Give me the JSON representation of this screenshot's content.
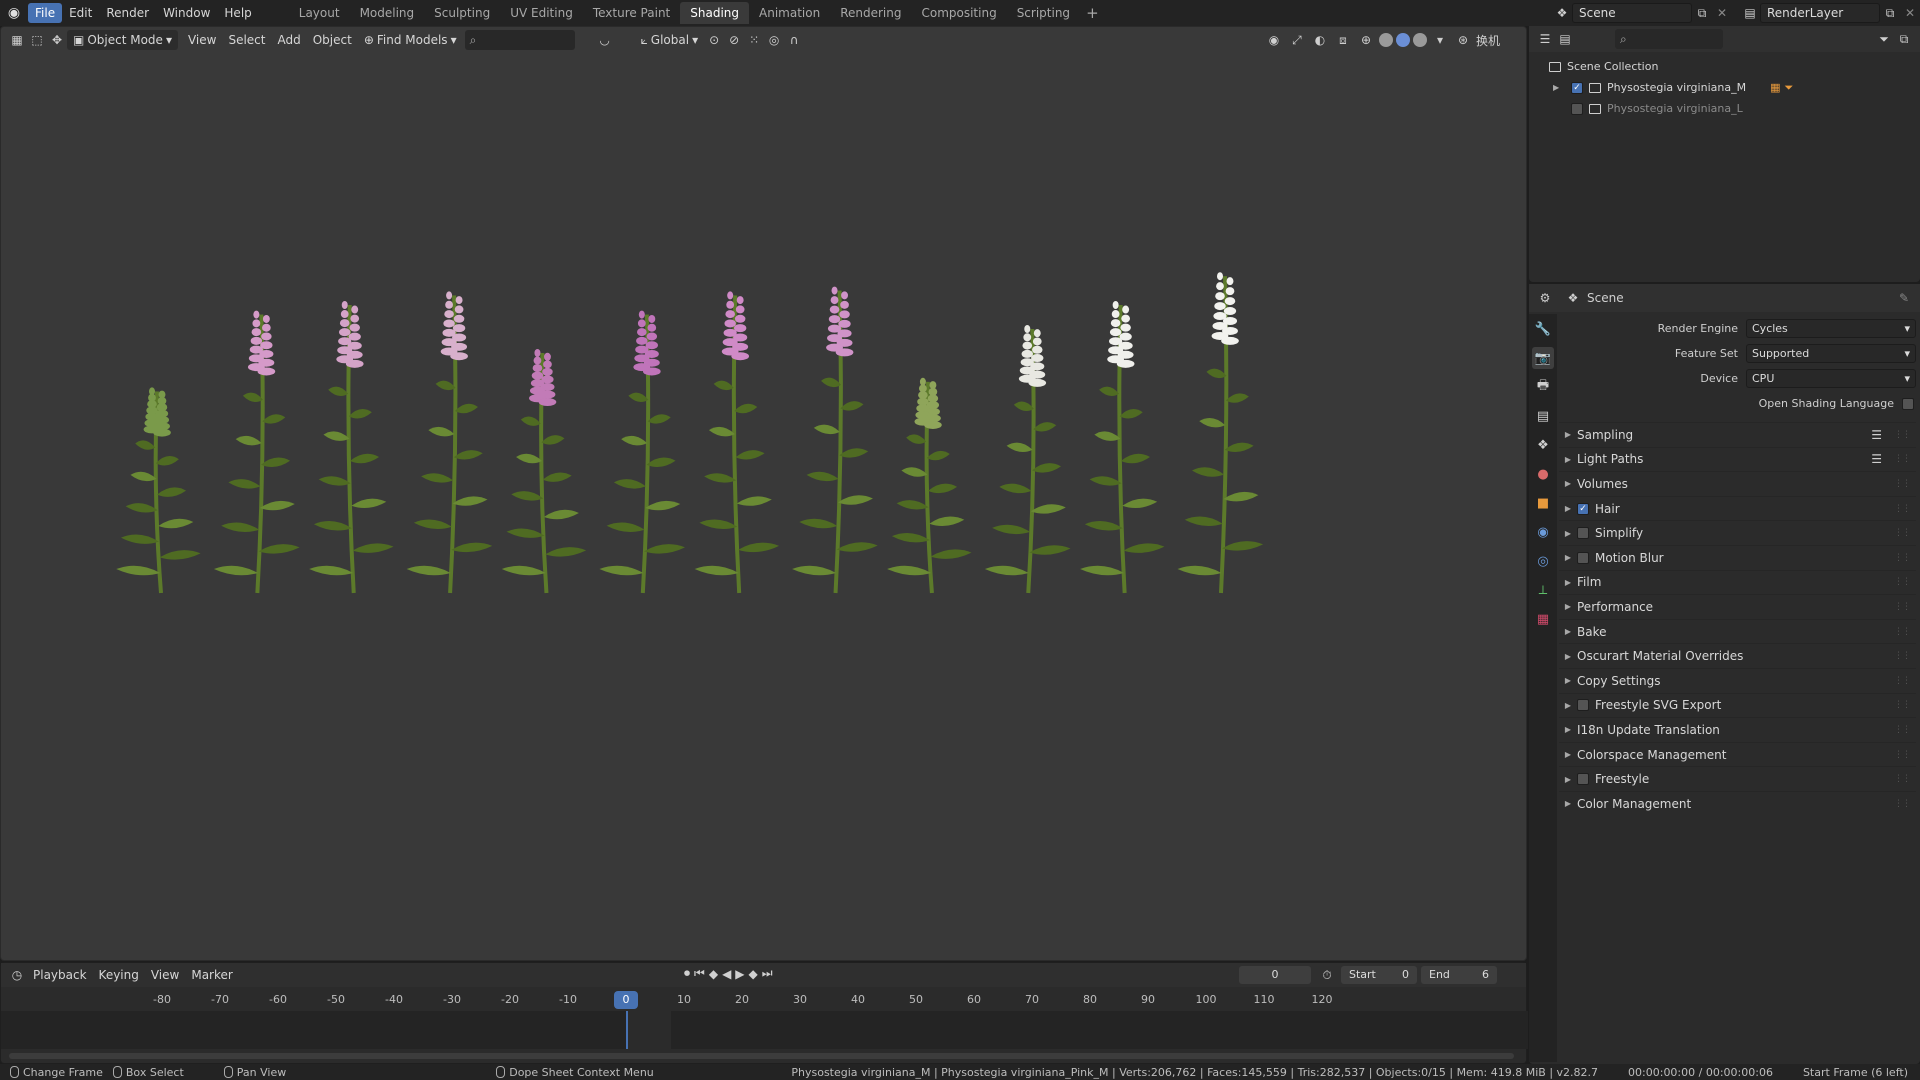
{
  "menu": [
    "File",
    "Edit",
    "Render",
    "Window",
    "Help"
  ],
  "workspaces": [
    "Layout",
    "Modeling",
    "Sculpting",
    "UV Editing",
    "Texture Paint",
    "Shading",
    "Animation",
    "Rendering",
    "Compositing",
    "Scripting"
  ],
  "active_workspace": "Shading",
  "scene_name": "Scene",
  "view_layer": "RenderLayer",
  "viewport": {
    "mode": "Object Mode",
    "menus": [
      "View",
      "Select",
      "Add",
      "Object"
    ],
    "addon_label": "Find Models",
    "transform_orientation": "Global",
    "camera_label": "换机"
  },
  "timeline": {
    "menus": [
      "Playback",
      "Keying",
      "View",
      "Marker"
    ],
    "current_frame": "0",
    "start_label": "Start",
    "start": "0",
    "end_label": "End",
    "end": "6",
    "ticks": [
      "-80",
      "-70",
      "-60",
      "-50",
      "-40",
      "-30",
      "-20",
      "-10",
      "0",
      "10",
      "20",
      "30",
      "40",
      "50",
      "60",
      "70",
      "80",
      "90",
      "100",
      "110",
      "120"
    ]
  },
  "outliner": {
    "root": "Scene Collection",
    "items": [
      {
        "label": "Physostegia virginiana_M",
        "checked": true
      },
      {
        "label": "Physostegia virginiana_L",
        "checked": false
      }
    ]
  },
  "properties": {
    "context": "Scene",
    "render_engine_label": "Render Engine",
    "render_engine": "Cycles",
    "feature_set_label": "Feature Set",
    "feature_set": "Supported",
    "device_label": "Device",
    "device": "CPU",
    "osl_label": "Open Shading Language",
    "panels": [
      {
        "label": "Sampling",
        "checkbox": null,
        "preset": true
      },
      {
        "label": "Light Paths",
        "checkbox": null,
        "preset": true
      },
      {
        "label": "Volumes",
        "checkbox": null,
        "preset": false
      },
      {
        "label": "Hair",
        "checkbox": true,
        "preset": false
      },
      {
        "label": "Simplify",
        "checkbox": false,
        "preset": false
      },
      {
        "label": "Motion Blur",
        "checkbox": false,
        "preset": false
      },
      {
        "label": "Film",
        "checkbox": null,
        "preset": false
      },
      {
        "label": "Performance",
        "checkbox": null,
        "preset": false
      },
      {
        "label": "Bake",
        "checkbox": null,
        "preset": false
      },
      {
        "label": "Oscurart Material Overrides",
        "checkbox": null,
        "preset": false
      },
      {
        "label": "Copy Settings",
        "checkbox": null,
        "preset": false
      },
      {
        "label": "Freestyle SVG Export",
        "checkbox": false,
        "preset": false
      },
      {
        "label": "I18n Update Translation",
        "checkbox": null,
        "preset": false
      },
      {
        "label": "Colorspace Management",
        "checkbox": null,
        "preset": false
      },
      {
        "label": "Freestyle",
        "checkbox": false,
        "preset": false
      },
      {
        "label": "Color Management",
        "checkbox": null,
        "preset": false
      }
    ]
  },
  "statusbar": {
    "change_frame": "Change Frame",
    "box_select": "Box Select",
    "pan_view": "Pan View",
    "context_menu": "Dope Sheet Context Menu",
    "stats": "Physostegia virginiana_M | Physostegia virginiana_Pink_M | Verts:206,762 | Faces:145,559 | Tris:282,537 | Objects:0/15 | Mem: 419.8 MiB | v2.82.7",
    "time": "00:00:00:00 / 00:00:00:06",
    "start_frame": "Start Frame (6 left)"
  },
  "colors": {
    "accent": "#4772b3",
    "viewport_bg": "#393939",
    "panel_bg": "#2b2b2b"
  },
  "plants": [
    {
      "color": "#7a9a4a",
      "height": 0.42
    },
    {
      "color": "#d59ac9",
      "height": 0.58
    },
    {
      "color": "#d4a3c8",
      "height": 0.6
    },
    {
      "color": "#d8b0cc",
      "height": 0.62
    },
    {
      "color": "#c27bb7",
      "height": 0.5
    },
    {
      "color": "#c074ba",
      "height": 0.58
    },
    {
      "color": "#d08ac7",
      "height": 0.62
    },
    {
      "color": "#d093c8",
      "height": 0.63
    },
    {
      "color": "#8fa55a",
      "height": 0.44
    },
    {
      "color": "#e8e8e2",
      "height": 0.55
    },
    {
      "color": "#f0f0ec",
      "height": 0.6
    },
    {
      "color": "#f2f2ee",
      "height": 0.66
    }
  ]
}
